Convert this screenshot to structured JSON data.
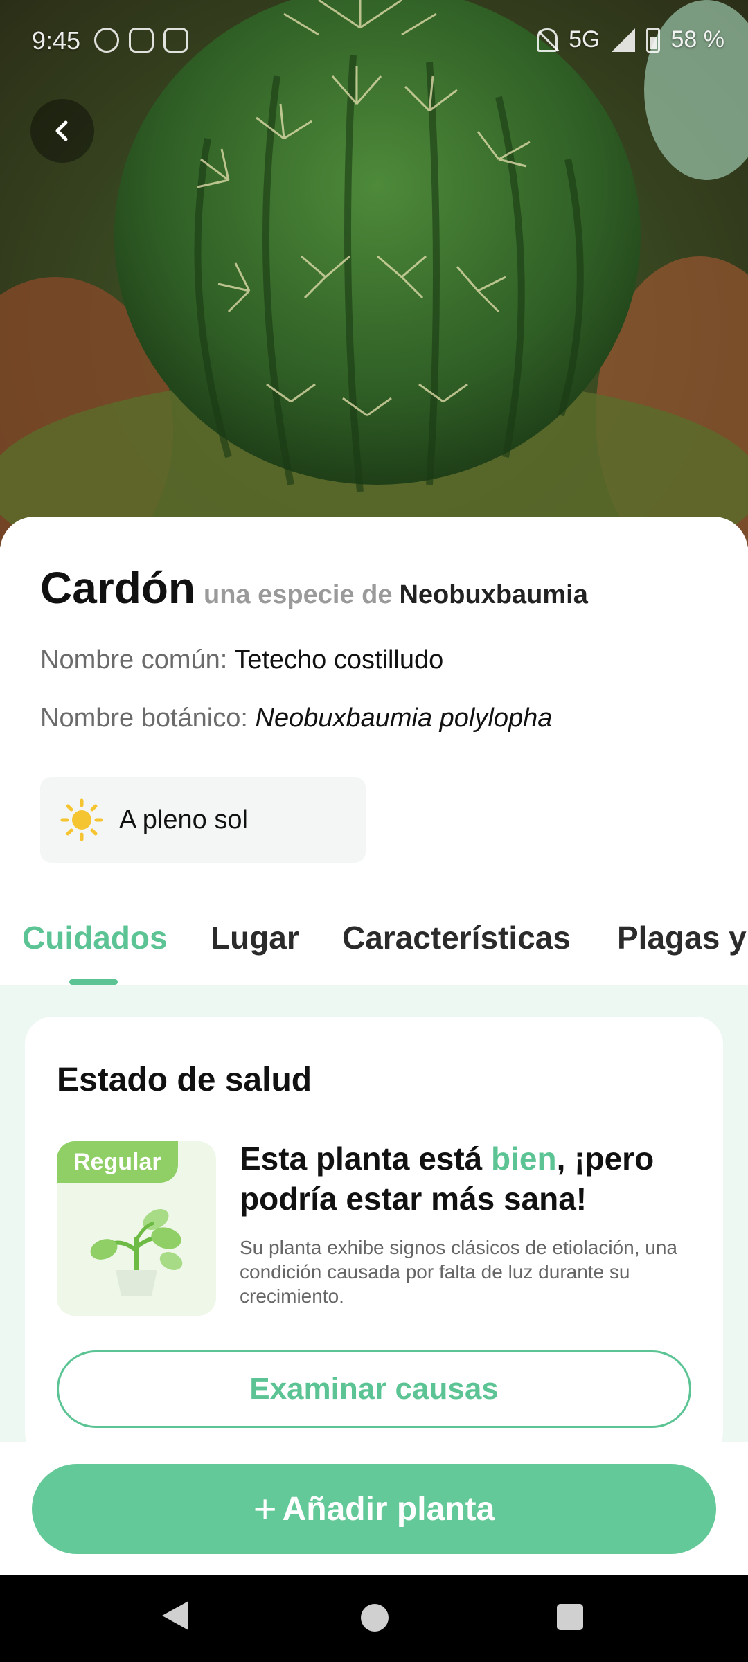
{
  "status_bar": {
    "time": "9:45",
    "battery": "58 %",
    "network": "5G",
    "icons": [
      "whatsapp-icon",
      "sim-icon",
      "instagram-icon",
      "mute-icon",
      "signal-icon",
      "battery-icon"
    ]
  },
  "hero": {
    "image": "cactus-photo",
    "back_icon": "chevron-left-icon"
  },
  "plant": {
    "name": "Cardón",
    "species_prefix": "una especie de",
    "genus": "Neobuxbaumia",
    "common_name_label": "Nombre común:",
    "common_name": "Tetecho costilludo",
    "botanical_name_label": "Nombre botánico:",
    "botanical_name": "Neobuxbaumia polylopha",
    "light_icon": "sun-icon",
    "light": "A pleno sol"
  },
  "tabs": [
    {
      "label": "Cuidados",
      "active": true
    },
    {
      "label": "Lugar",
      "active": false
    },
    {
      "label": "Características",
      "active": false
    },
    {
      "label": "Plagas y",
      "active": false
    }
  ],
  "health": {
    "title": "Estado de salud",
    "badge": "Regular",
    "headline_start": "Esta planta está ",
    "headline_highlight": "bien",
    "headline_end": ", ¡pero podría estar más sana!",
    "description": "Su planta exhibe signos clásicos de etiolación, una condición causada por falta de luz durante su crecimiento.",
    "examine_button": "Examinar causas"
  },
  "add_button": {
    "icon": "plus-icon",
    "label": "Añadir planta"
  },
  "colors": {
    "accent": "#5cc494",
    "add_button": "#64c998",
    "badge": "#8fcf66",
    "content_bg": "#eef8f3"
  },
  "nav": {
    "back_icon": "nav-back-icon",
    "home_icon": "nav-home-icon",
    "recents_icon": "nav-recents-icon"
  }
}
